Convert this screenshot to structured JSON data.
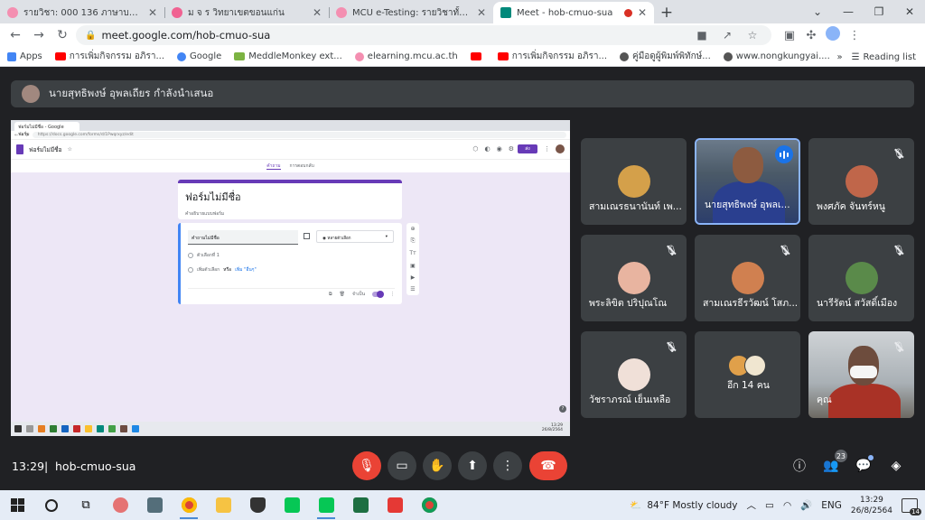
{
  "browser": {
    "tabs": [
      {
        "title": "รายวิชา: 000 136 ภาษาบาลี-ดร.ภูษิต",
        "color": "#f48fb1",
        "active": false
      },
      {
        "title": "ม จ ร วิทยาเขตขอนแก่น",
        "color": "#f06292",
        "active": false
      },
      {
        "title": "MCU e-Testing: รายวิชาทั้งหมด",
        "color": "#f48fb1",
        "active": false
      },
      {
        "title": "Meet - hob-cmuo-sua",
        "color": "#00897b",
        "active": true
      }
    ],
    "url": "meet.google.com/hob-cmuo-sua",
    "bookmarks": [
      {
        "label": "Apps",
        "color": "#4285f4"
      },
      {
        "label": "การเพิ่มกิจกรรม อภิรา...",
        "color": "#ff0000"
      },
      {
        "label": "Google",
        "color": "#4285f4"
      },
      {
        "label": "MeddleMonkey ext...",
        "color": "#7cb342"
      },
      {
        "label": "elearning.mcu.ac.th",
        "color": "#f48fb1"
      },
      {
        "label": "",
        "color": "#ff0000"
      },
      {
        "label": "การเพิ่มกิจกรรม อภิรา...",
        "color": "#ff0000"
      },
      {
        "label": "คู่มือดูผู้พิมพ์พิทักษ์...",
        "color": "#555555"
      },
      {
        "label": "www.nongkungyai....",
        "color": "#555555"
      }
    ],
    "reading_list": "Reading list"
  },
  "presenter": {
    "text": "นายสุทธิพงษ์ อุพลเถียร กำลังนำเสนอ"
  },
  "shared_screen": {
    "tab_title": "ฟอร์มไม่มีชื่อ - Google ฟอร์ม",
    "address": "https://docs.google.com/forms/d/1Pwqrxyz/edit",
    "form_name": "ฟอร์มไม่มีชื่อ",
    "send_label": "ส่ง",
    "tabs": [
      "คำถาม",
      "การตอบกลับ"
    ],
    "title": "ฟอร์มไม่มีชื่อ",
    "description": "คำอธิบายแบบฟอร์ม",
    "question_placeholder": "คำถามไม่มีชื่อ",
    "question_type": "หลายตัวเลือก",
    "option1": "ตัวเลือกที่ 1",
    "add_option": "เพิ่มตัวเลือก",
    "or_text": "หรือ",
    "add_other": "เพิ่ม \"อื่นๆ\"",
    "required_label": "จำเป็น",
    "clock_time": "13:29",
    "clock_date": "26/8/2564"
  },
  "participants": [
    {
      "name": "สามเณรธนานันท์ เพ...",
      "muted": false,
      "avatar_color": "#d4a04a"
    },
    {
      "name": "นายสุทธิพงษ์ อุพลเ...",
      "muted": false,
      "speaking": true
    },
    {
      "name": "พงศภัค จันทร์หนู",
      "muted": true,
      "avatar_color": "#c0664a"
    },
    {
      "name": "พระลิขิต ปริปุณโณ",
      "muted": true,
      "avatar_color": "#e8b4a0"
    },
    {
      "name": "สามเณรธีรวัฒน์ โสภ...",
      "muted": true,
      "avatar_color": "#d08050"
    },
    {
      "name": "นารีรัตน์ สวัสดิ์เมือง",
      "muted": true,
      "avatar_color": "#5a8a4a"
    },
    {
      "name": "วัชราภรณ์ เย็นเหลือ",
      "muted": true,
      "avatar_color": "#f0e0d8"
    },
    {
      "name": "อีก 14 คน",
      "muted": false
    },
    {
      "name": "คุณ",
      "muted": true
    }
  ],
  "meeting": {
    "time": "13:29",
    "separator": "|",
    "code": "hob-cmuo-sua",
    "people_count": "23"
  },
  "taskbar": {
    "weather": "84°F Mostly cloudy",
    "lang": "ENG",
    "time": "13:29",
    "date": "26/8/2564",
    "notifications": "14"
  }
}
